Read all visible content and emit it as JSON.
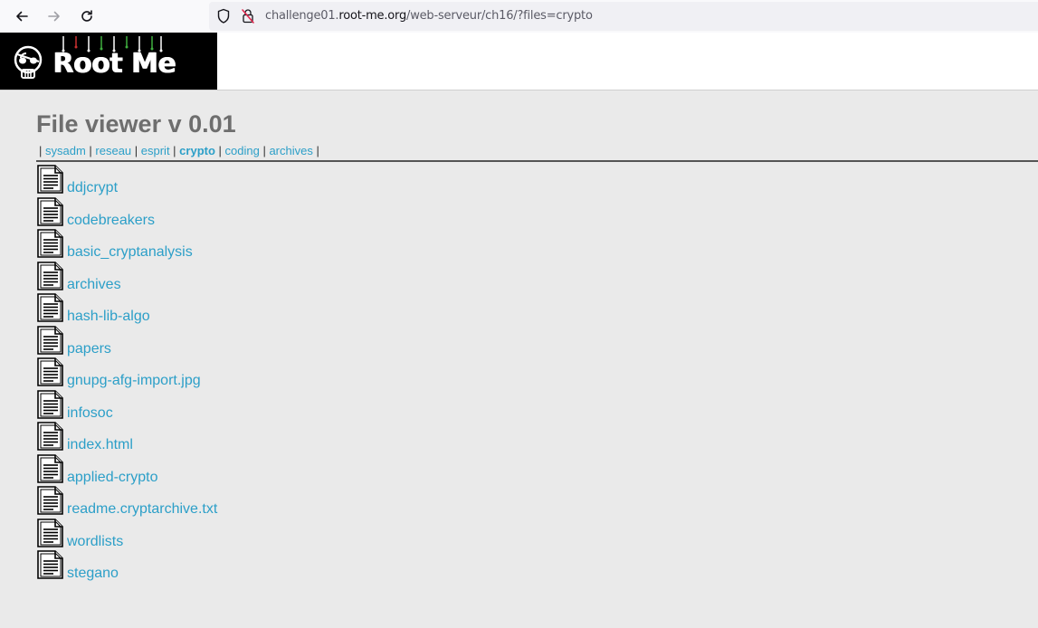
{
  "browser": {
    "url_prefix": "challenge01.",
    "url_host": "root-me.org",
    "url_path": "/web-serveur/ch16/?files=crypto"
  },
  "header": {
    "logo_text": "Root Me"
  },
  "page": {
    "title": "File viewer v 0.01",
    "categories": [
      {
        "label": "sysadm",
        "active": false
      },
      {
        "label": "reseau",
        "active": false
      },
      {
        "label": "esprit",
        "active": false
      },
      {
        "label": "crypto",
        "active": true
      },
      {
        "label": "coding",
        "active": false
      },
      {
        "label": "archives",
        "active": false
      }
    ],
    "separator": "|",
    "files": [
      "ddjcrypt",
      "codebreakers",
      "basic_cryptanalysis",
      "archives",
      "hash-lib-algo",
      "papers",
      "gnupg-afg-import.jpg",
      "infosoc",
      "index.html",
      "applied-crypto",
      "readme.cryptarchive.txt",
      "wordlists",
      "stegano"
    ]
  },
  "colors": {
    "link": "#2c9fc8",
    "title": "#6e6e6e",
    "background": "#eaeaea"
  }
}
